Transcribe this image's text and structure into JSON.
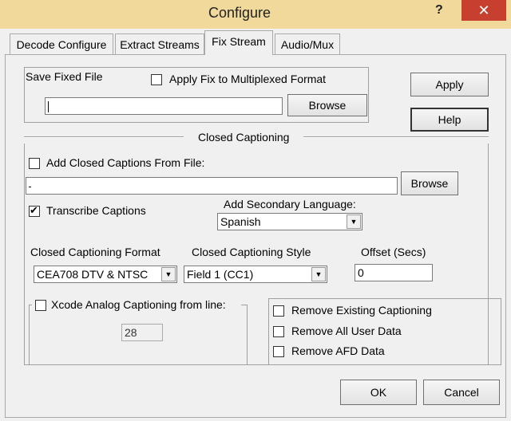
{
  "window": {
    "title": "Configure",
    "help_glyph": "?",
    "close_glyph": "✕"
  },
  "tabs": [
    {
      "label": "Decode Configure"
    },
    {
      "label": "Extract Streams"
    },
    {
      "label": "Fix Stream"
    },
    {
      "label": "Audio/Mux"
    }
  ],
  "save": {
    "group_label": "Save Fixed File",
    "apply_fix_label": "Apply Fix to Multiplexed Format",
    "apply_fix_checked": false,
    "file_value": "",
    "browse_label": "Browse"
  },
  "side_buttons": {
    "apply_label": "Apply",
    "help_label": "Help"
  },
  "cc": {
    "section_title": "Closed Captioning",
    "add_from_file_label": "Add Closed Captions From File:",
    "add_from_file_checked": false,
    "file_value": "",
    "browse_label": "Browse",
    "transcribe_label": "Transcribe Captions",
    "transcribe_checked": true,
    "secondary_language_label": "Add Secondary Language:",
    "secondary_language_value": "Spanish",
    "format_label": "Closed Captioning Format",
    "format_value": "CEA708 DTV & NTSC",
    "style_label": "Closed Captioning Style",
    "style_value": "Field 1 (CC1)",
    "offset_label": "Offset (Secs)",
    "offset_value": "0",
    "xcode_label": "Xcode Analog Captioning from line:",
    "xcode_checked": false,
    "xcode_line_value": "28",
    "remove_existing_label": "Remove Existing Captioning",
    "remove_user_data_label": "Remove All User Data",
    "remove_afd_label": "Remove AFD Data"
  },
  "footer": {
    "ok_label": "OK",
    "cancel_label": "Cancel"
  }
}
